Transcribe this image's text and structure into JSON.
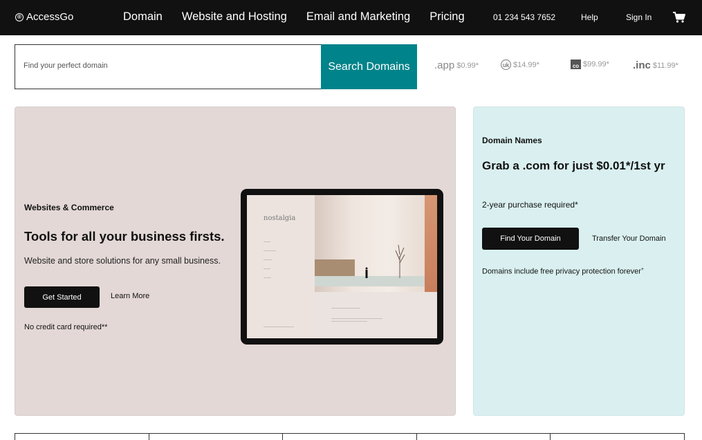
{
  "nav": {
    "logo": "AccessGo",
    "menu": [
      "Domain",
      "Website and Hosting",
      "Email and Marketing",
      "Pricing"
    ],
    "phone": "01 234 543 7652",
    "help": "Help",
    "signin": "Sign In",
    "cart_icon": "cart-icon"
  },
  "search": {
    "placeholder": "Find your perfect domain",
    "button_label": "Search Domains"
  },
  "tlds": [
    {
      "name": ".app",
      "price": "$0.99*"
    },
    {
      "name": ".co.uk",
      "price": "$14.99*"
    },
    {
      "name": ".co",
      "price": "$99.99*"
    },
    {
      "name": ".inc",
      "price": "$11.99*"
    }
  ],
  "hero": {
    "eyebrow": "Websites & Commerce",
    "headline": "Tools for all your business firsts.",
    "subtext": "Website and store solutions for any small business.",
    "primary_label": "Get Started",
    "secondary_label": "Learn More",
    "note": "No credit card required**",
    "tablet_brand": "nostalgia"
  },
  "domain_card": {
    "eyebrow": "Domain Names",
    "headline": "Grab a .com for just $0.01*/1st yr",
    "requirement": "2-year purchase required*",
    "primary_label": "Find Your Domain",
    "secondary_label": "Transfer Your Domain",
    "privacy": "Domains include free privacy protection forever",
    "privacy_mark": "+"
  },
  "colors": {
    "nav_bg": "#111111",
    "search_button": "#00838a",
    "hero_bg": "#e3d8d6",
    "domain_card_bg": "#daf0f0"
  }
}
